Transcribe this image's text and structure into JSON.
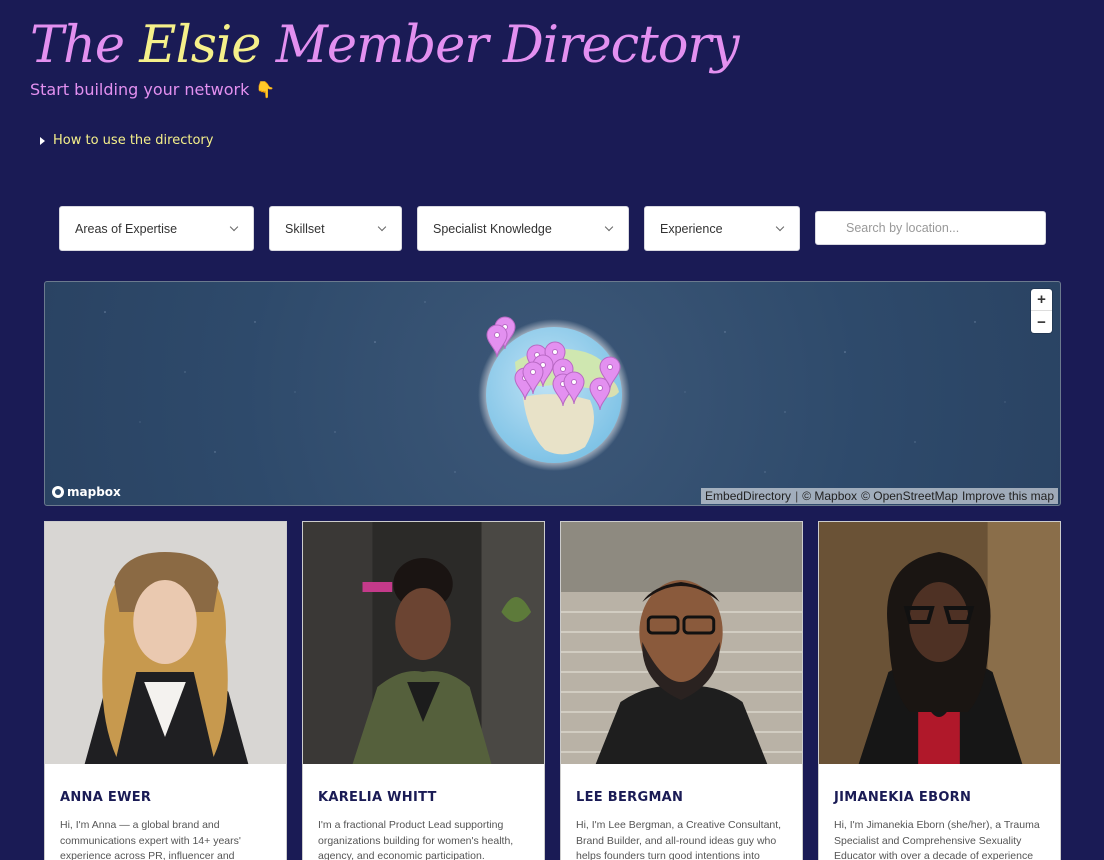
{
  "header": {
    "title_prefix": "The ",
    "title_highlight": "Elsie",
    "title_suffix": " Member Directory",
    "subtitle": "Start building your network",
    "subtitle_emoji": "👇"
  },
  "howto": {
    "label": "How to use the directory"
  },
  "filters": {
    "areas": "Areas of Expertise",
    "skillset": "Skillset",
    "specialist": "Specialist Knowledge",
    "experience": "Experience",
    "search_placeholder": "Search by location..."
  },
  "map": {
    "zoom_in": "+",
    "zoom_out": "−",
    "logo": "mapbox",
    "attrib_embed": "EmbedDirectory",
    "attrib_sep": "|",
    "attrib_mapbox": "© Mapbox",
    "attrib_osm": "© OpenStreetMap",
    "attrib_improve": "Improve this map",
    "accent": "#e390f0"
  },
  "members": [
    {
      "name": "ANNA EWER",
      "bio": "Hi, I'm Anna — a global brand and communications expert with 14+ years' experience across PR, influencer and"
    },
    {
      "name": "KARELIA WHITT",
      "bio": "I'm a fractional Product Lead supporting organizations building for women's health, agency, and economic participation."
    },
    {
      "name": "LEE BERGMAN",
      "bio": "Hi, I'm Lee Bergman, a Creative Consultant, Brand Builder, and all-round ideas guy who helps founders turn good intentions into"
    },
    {
      "name": "JIMANEKIA EBORN",
      "bio": "Hi, I'm Jimanekia Eborn (she/her), a Trauma Specialist and Comprehensive Sexuality Educator with over a decade of experience"
    }
  ]
}
